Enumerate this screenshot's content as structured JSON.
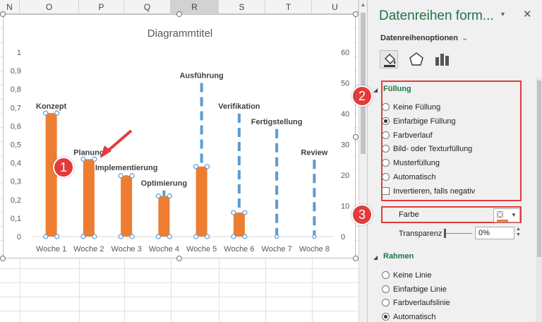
{
  "spreadsheet": {
    "columns": [
      "N",
      "O",
      "P",
      "Q",
      "R",
      "S",
      "T",
      "U"
    ],
    "selected_column": "R"
  },
  "chart": {
    "title": "Diagrammtitel",
    "accent_color": "#ed7d31",
    "secondary_color": "#5b9bd5",
    "chart_data": {
      "type": "bar",
      "title": "Diagrammtitel",
      "categories": [
        "Woche 1",
        "Woche 2",
        "Woche 3",
        "Woche 4",
        "Woche 5",
        "Woche 6",
        "Woche 7",
        "Woche 8"
      ],
      "series": [
        {
          "values": [
            0.67,
            0.42,
            0.33,
            0.22,
            0.38,
            0.13,
            0,
            0
          ]
        },
        {
          "values": [
            40,
            25,
            20,
            15,
            50,
            40,
            35,
            25
          ]
        }
      ],
      "ylim": [
        0,
        1
      ],
      "y_ticks": [
        "0",
        "0,1",
        "0,2",
        "0,3",
        "0,4",
        "0,5",
        "0,6",
        "0,7",
        "0,8",
        "0,9",
        "1"
      ],
      "y2lim": [
        0,
        60
      ],
      "y2_ticks": [
        "0",
        "10",
        "20",
        "30",
        "40",
        "50",
        "60"
      ],
      "annotations": [
        {
          "label": "Konzept",
          "x": "Woche 1",
          "y2": 40
        },
        {
          "label": "Planung",
          "x": "Woche 2",
          "y2": 25
        },
        {
          "label": "Implementierung",
          "x": "Woche 3",
          "y2": 20
        },
        {
          "label": "Optimierung",
          "x": "Woche 4",
          "y2": 15
        },
        {
          "label": "Ausführung",
          "x": "Woche 5",
          "y2": 50
        },
        {
          "label": "Verifikation",
          "x": "Woche 6",
          "y2": 40
        },
        {
          "label": "Fertigstellung",
          "x": "Woche 7",
          "y2": 35
        },
        {
          "label": "Review",
          "x": "Woche 8",
          "y2": 25
        }
      ],
      "grid": false,
      "legend": "none"
    }
  },
  "callouts": [
    "1",
    "2",
    "3"
  ],
  "pane": {
    "title": "Datenreihen form...",
    "close_label": "✕",
    "dropdown_label": "▼",
    "series_options": "Datenreihenoptionen",
    "tabs": [
      "fill-line",
      "effects",
      "series-options"
    ],
    "fill": {
      "heading": "Füllung",
      "options": [
        {
          "label": "Keine Füllung",
          "selected": false
        },
        {
          "label": "Einfarbige Füllung",
          "selected": true
        },
        {
          "label": "Farbverlauf",
          "selected": false
        },
        {
          "label": "Bild- oder Texturfüllung",
          "selected": false
        },
        {
          "label": "Musterfüllung",
          "selected": false
        },
        {
          "label": "Automatisch",
          "selected": false
        }
      ],
      "invert_label": "Invertieren, falls negativ",
      "color_label": "Farbe",
      "color_value": "#ed7d31",
      "transparency_label": "Transparenz",
      "transparency_value": "0%"
    },
    "border": {
      "heading": "Rahmen",
      "options": [
        {
          "label": "Keine Linie",
          "selected": false
        },
        {
          "label": "Einfarbige Linie",
          "selected": false
        },
        {
          "label": "Farbverlaufslinie",
          "selected": false
        },
        {
          "label": "Automatisch",
          "selected": true
        }
      ]
    }
  }
}
